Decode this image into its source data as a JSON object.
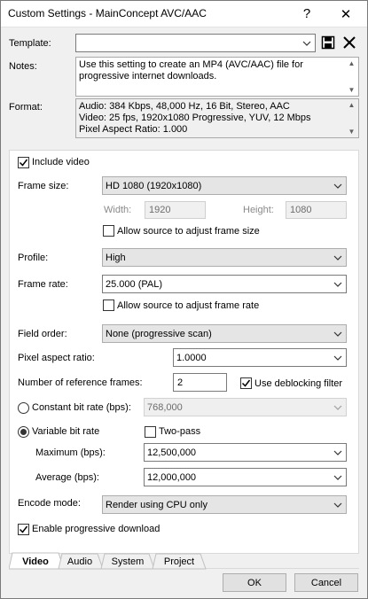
{
  "window": {
    "title": "Custom Settings - MainConcept AVC/AAC",
    "help_glyph": "?",
    "close_glyph": "✕"
  },
  "template": {
    "label": "Template:",
    "value": ""
  },
  "notes": {
    "label": "Notes:",
    "text": "Use this setting to create an MP4 (AVC/AAC) file for progressive internet downloads."
  },
  "format": {
    "label": "Format:",
    "lines": [
      "Audio: 384 Kbps, 48,000 Hz, 16 Bit, Stereo, AAC",
      "Video: 25 fps, 1920x1080 Progressive, YUV, 12 Mbps",
      "Pixel Aspect Ratio: 1.000"
    ]
  },
  "video": {
    "include_video_label": "Include video",
    "frame_size_label": "Frame size:",
    "frame_size_value": "HD 1080 (1920x1080)",
    "width_label": "Width:",
    "width_value": "1920",
    "height_label": "Height:",
    "height_value": "1080",
    "allow_frame_size_label": "Allow source to adjust frame size",
    "profile_label": "Profile:",
    "profile_value": "High",
    "frame_rate_label": "Frame rate:",
    "frame_rate_value": "25.000 (PAL)",
    "allow_frame_rate_label": "Allow source to adjust frame rate",
    "field_order_label": "Field order:",
    "field_order_value": "None (progressive scan)",
    "par_label": "Pixel aspect ratio:",
    "par_value": "1.0000",
    "ref_frames_label": "Number of reference frames:",
    "ref_frames_value": "2",
    "deblocking_label": "Use deblocking filter",
    "cbr_label": "Constant bit rate (bps):",
    "cbr_value": "768,000",
    "vbr_label": "Variable bit rate",
    "two_pass_label": "Two-pass",
    "max_label": "Maximum (bps):",
    "max_value": "12,500,000",
    "avg_label": "Average (bps):",
    "avg_value": "12,000,000",
    "encode_mode_label": "Encode mode:",
    "encode_mode_value": "Render using CPU only",
    "progressive_label": "Enable progressive download"
  },
  "tabs": [
    "Video",
    "Audio",
    "System",
    "Project"
  ],
  "buttons": {
    "ok": "OK",
    "cancel": "Cancel"
  }
}
